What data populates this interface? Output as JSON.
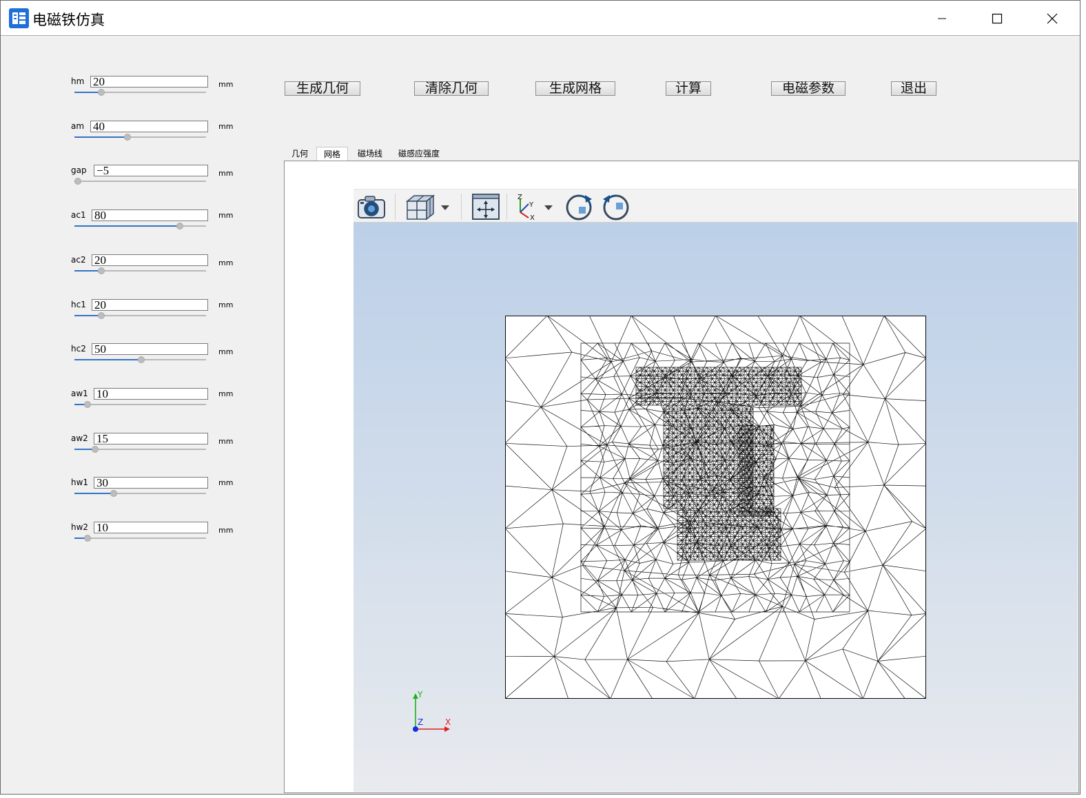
{
  "window": {
    "title": "电磁铁仿真"
  },
  "params": [
    {
      "name": "hm",
      "value": "20",
      "unit": "mm",
      "fraction": 0.19
    },
    {
      "name": "am",
      "value": "40",
      "unit": "mm",
      "fraction": 0.4
    },
    {
      "name": "gap",
      "value": "−5",
      "unit": "mm",
      "fraction": 0.0
    },
    {
      "name": "ac1",
      "value": "80",
      "unit": "mm",
      "fraction": 0.82
    },
    {
      "name": "ac2",
      "value": "20",
      "unit": "mm",
      "fraction": 0.19
    },
    {
      "name": "hc1",
      "value": "20",
      "unit": "mm",
      "fraction": 0.19
    },
    {
      "name": "hc2",
      "value": "50",
      "unit": "mm",
      "fraction": 0.51
    },
    {
      "name": "aw1",
      "value": "10",
      "unit": "mm",
      "fraction": 0.08
    },
    {
      "name": "aw2",
      "value": "15",
      "unit": "mm",
      "fraction": 0.14
    },
    {
      "name": "hw1",
      "value": "30",
      "unit": "mm",
      "fraction": 0.29
    },
    {
      "name": "hw2",
      "value": "10",
      "unit": "mm",
      "fraction": 0.08
    }
  ],
  "actions": {
    "gen_geometry": "生成几何",
    "clear_geometry": "清除几何",
    "gen_mesh": "生成网格",
    "compute": "计算",
    "em_params": "电磁参数",
    "exit": "退出"
  },
  "tabs": {
    "geometry": "几何",
    "mesh": "网格",
    "field_lines": "磁场线",
    "flux_density": "磁感应强度",
    "active": "网格"
  },
  "toolbar": {
    "icons": [
      "camera-icon",
      "view-cube-icon",
      "fit-view-icon",
      "axes-orientation-icon",
      "rotate-cw-icon",
      "rotate-ccw-icon"
    ],
    "axis_labels": {
      "z": "Z",
      "y": "Y",
      "x": "X"
    }
  },
  "orientation_triad": {
    "y": "Y",
    "z": "Z",
    "x": "X"
  },
  "colors": {
    "slider_fill": "#3372c4",
    "axis_x": "#e02020",
    "axis_y": "#20b020",
    "axis_z": "#1030e0"
  }
}
